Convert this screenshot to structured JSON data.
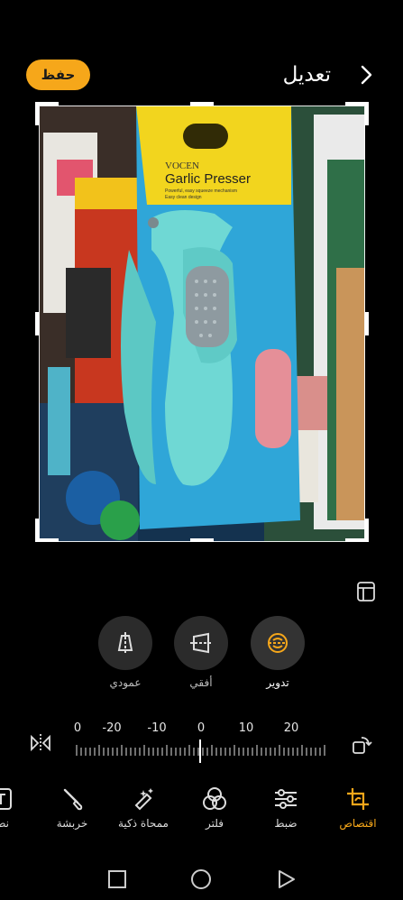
{
  "header": {
    "title": "تعديل",
    "save_label": "حفظ",
    "back_icon": "chevron-right-icon",
    "accent_color": "#F6A71A"
  },
  "photo": {
    "package_brand": "VOCEN",
    "package_title": "Garlic Presser",
    "package_subtitle": "Powerful, easy squeeze mechanism",
    "package_subtitle2": "Easy clean design"
  },
  "rotate_tools": [
    {
      "id": "rotate",
      "label": "تدوير",
      "icon": "rotate-icon",
      "active": true
    },
    {
      "id": "horizontal",
      "label": "أفقي",
      "icon": "horizontal-skew-icon",
      "active": false
    },
    {
      "id": "vertical",
      "label": "عمودي",
      "icon": "vertical-skew-icon",
      "active": false
    }
  ],
  "ruler": {
    "labels": [
      "0",
      "-20",
      "-10",
      "0",
      "10",
      "20"
    ],
    "current_value": 0
  },
  "toolbar": [
    {
      "id": "crop",
      "label": "اقتصاص",
      "icon": "crop-icon",
      "active": true
    },
    {
      "id": "adjust",
      "label": "ضبط",
      "icon": "sliders-icon",
      "active": false
    },
    {
      "id": "filter",
      "label": "فلتر",
      "icon": "filter-circles-icon",
      "active": false
    },
    {
      "id": "smart-eraser",
      "label": "ممحاة ذكية",
      "icon": "magic-eraser-icon",
      "active": false
    },
    {
      "id": "doodle",
      "label": "خربشة",
      "icon": "brush-icon",
      "active": false
    },
    {
      "id": "text",
      "label": "نص",
      "icon": "text-icon",
      "active": false
    }
  ]
}
